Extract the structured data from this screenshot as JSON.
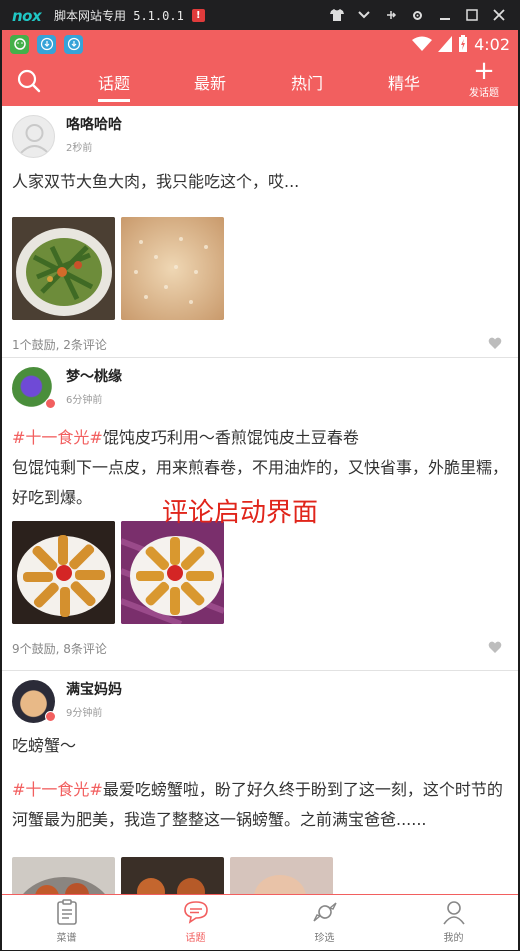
{
  "emulator": {
    "logo": "nox",
    "title": "脚本网站专用 5.1.0.1",
    "alert": "!"
  },
  "status": {
    "time": "4:02"
  },
  "nav": {
    "tabs": [
      "话题",
      "最新",
      "热门",
      "精华"
    ],
    "active_tab": "话题",
    "post_label": "发话题"
  },
  "posts": [
    {
      "username": "咯咯哈哈",
      "time": "2秒前",
      "tag": "",
      "text": "人家双节大鱼大肉，我只能吃这个，哎...",
      "stats": "1个鼓励,   2条评论"
    },
    {
      "username": "梦～桃缘",
      "time": "6分钟前",
      "tag": "#十一食光#",
      "tag_rest": "馄饨皮巧利用～香煎馄饨皮土豆春卷",
      "text": "包馄饨剩下一点皮，用来煎春卷，不用油炸的，又快省事，外脆里糯，好吃到爆。",
      "stats": "9个鼓励,   8条评论"
    },
    {
      "username": "满宝妈妈",
      "time": "9分钟前",
      "title": "吃螃蟹～",
      "tag": "#十一食光#",
      "text": "最爱吃螃蟹啦，盼了好久终于盼到了这一刻，这个时节的河蟹最为肥美，我造了整整这一锅螃蟹。之前满宝爸爸......"
    }
  ],
  "overlay_label": "评论启动界面",
  "tabbar": {
    "items": [
      "菜谱",
      "话题",
      "珍选",
      "我的"
    ],
    "active": "话题"
  },
  "colors": {
    "brand": "#f25f5f",
    "overlay_text": "#e0251b"
  }
}
